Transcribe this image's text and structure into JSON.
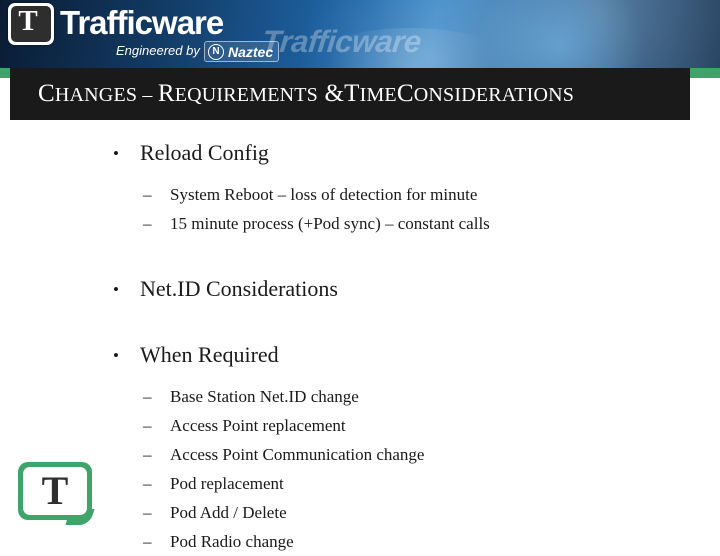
{
  "banner": {
    "logo_word": "Trafficware",
    "logo_badge_letter": "T",
    "tagline": "Engineered by",
    "partner_initial": "N",
    "partner_name": "Naztec",
    "watermark_text": "Trafficware"
  },
  "slide": {
    "title_parts": {
      "p1_big": "C",
      "p1_rest": "hanges",
      "dash": " – ",
      "p2_big": "R",
      "p2_rest": "equirements",
      "amp": " &",
      "p3_big": "T",
      "p3_rest": "ime",
      "p4_big": "C",
      "p4_rest": "onsiderations"
    },
    "title_full": "Changes – Requirements &Time Considerations",
    "bullet_glyph": "•",
    "dash_glyph": "–",
    "blocks": [
      {
        "heading": "Reload Config",
        "sub_items": [
          "System Reboot – loss of detection for minute",
          "15 minute process (+Pod sync) – constant calls"
        ]
      },
      {
        "heading": "Net.ID Considerations",
        "sub_items": []
      },
      {
        "heading": "When Required",
        "sub_items": [
          "Base Station Net.ID change",
          "Access Point replacement",
          "Access Point Communication change",
          "Pod replacement",
          "Pod Add / Delete",
          "Pod Radio change"
        ]
      }
    ]
  },
  "footer": {
    "logo_letter": "T"
  },
  "colors": {
    "accent_green": "#3ea46a",
    "title_bar": "#1a1a1a",
    "banner_blue": "#1d5f9e",
    "text": "#1a1a1a"
  }
}
